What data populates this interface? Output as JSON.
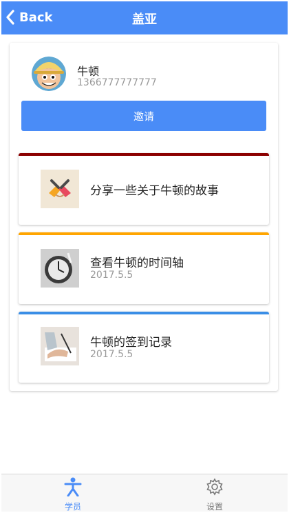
{
  "header": {
    "back_label": "Back",
    "title": "盖亚"
  },
  "profile": {
    "name": "牛顿",
    "phone": "1366777777777",
    "invite_label": "邀请"
  },
  "items": [
    {
      "label": "分享一些关于牛顿的故事",
      "date": "",
      "accent": "#8B0000"
    },
    {
      "label": "查看牛顿的时间轴",
      "date": "2017.5.5",
      "accent": "#FFA500"
    },
    {
      "label": "牛顿的签到记录",
      "date": "2017.5.5",
      "accent": "#3A8EE6"
    }
  ],
  "tabs": [
    {
      "label": "学员",
      "icon": "person-icon",
      "active": true
    },
    {
      "label": "设置",
      "icon": "gear-icon",
      "active": false
    }
  ],
  "colors": {
    "primary": "#4A8CF7",
    "tab_active": "#4A8CF7",
    "tab_inactive": "#777777"
  }
}
